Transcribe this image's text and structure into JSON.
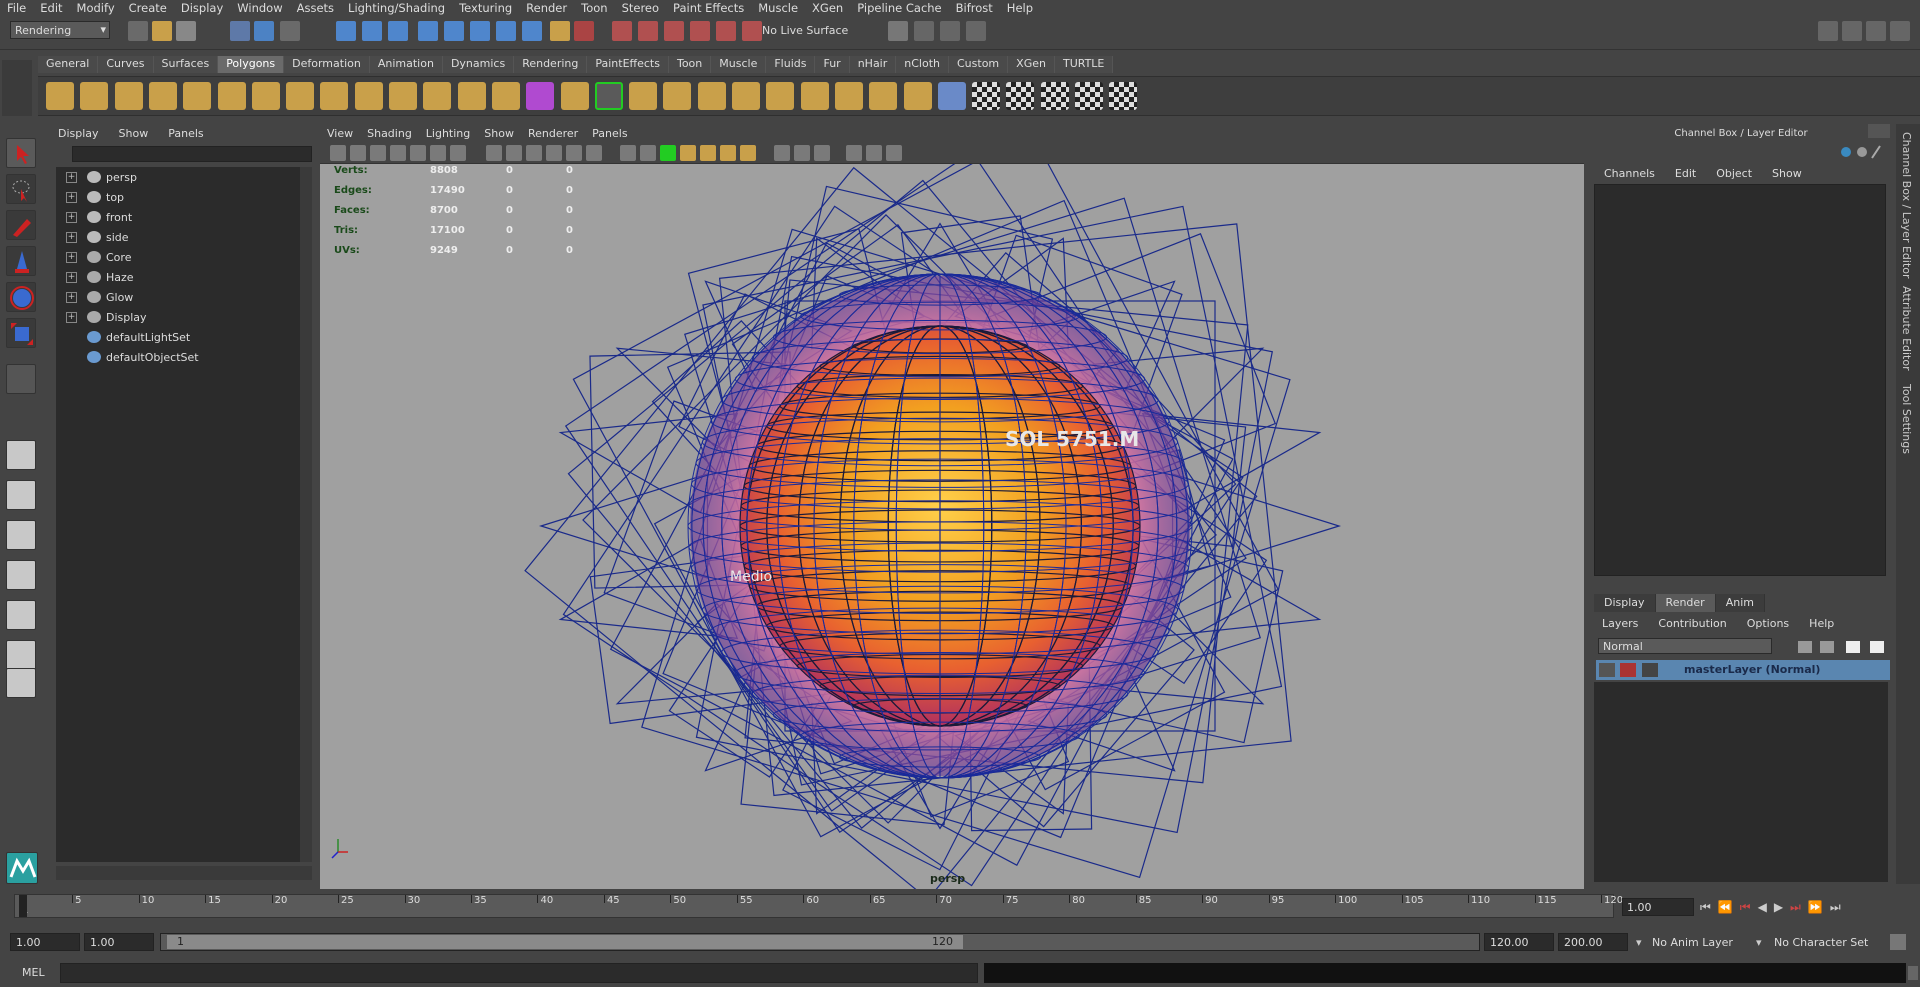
{
  "menubar": {
    "items": [
      "File",
      "Edit",
      "Modify",
      "Create",
      "Display",
      "Window",
      "Assets",
      "Lighting/Shading",
      "Texturing",
      "Render",
      "Toon",
      "Stereo",
      "Paint Effects",
      "Muscle",
      "XGen",
      "Pipeline Cache",
      "Bifrost",
      "Help"
    ]
  },
  "status": {
    "menuset": "Rendering",
    "live_surface": "No Live Surface"
  },
  "shelf": {
    "tabs": [
      "General",
      "Curves",
      "Surfaces",
      "Polygons",
      "Deformation",
      "Animation",
      "Dynamics",
      "Rendering",
      "PaintEffects",
      "Toon",
      "Muscle",
      "Fluids",
      "Fur",
      "nHair",
      "nCloth",
      "Custom",
      "XGen",
      "TURTLE"
    ],
    "active": "Polygons"
  },
  "outliner": {
    "menu": [
      "Display",
      "Show",
      "Panels"
    ],
    "items": [
      {
        "label": "persp",
        "type": "camera",
        "expand": true
      },
      {
        "label": "top",
        "type": "camera",
        "expand": true
      },
      {
        "label": "front",
        "type": "camera",
        "expand": true
      },
      {
        "label": "side",
        "type": "camera",
        "expand": true
      },
      {
        "label": "Core",
        "type": "group",
        "expand": true
      },
      {
        "label": "Haze",
        "type": "group",
        "expand": true
      },
      {
        "label": "Glow",
        "type": "group",
        "expand": true
      },
      {
        "label": "Display",
        "type": "group",
        "expand": true
      },
      {
        "label": "defaultLightSet",
        "type": "set",
        "expand": false
      },
      {
        "label": "defaultObjectSet",
        "type": "set",
        "expand": false
      }
    ]
  },
  "viewport": {
    "menu": [
      "View",
      "Shading",
      "Lighting",
      "Show",
      "Renderer",
      "Panels"
    ],
    "camera_label": "persp",
    "hud": [
      {
        "label": "Verts:",
        "v1": "8808",
        "v2": "0",
        "v3": "0"
      },
      {
        "label": "Edges:",
        "v1": "17490",
        "v2": "0",
        "v3": "0"
      },
      {
        "label": "Faces:",
        "v1": "8700",
        "v2": "0",
        "v3": "0"
      },
      {
        "label": "Tris:",
        "v1": "17100",
        "v2": "0",
        "v3": "0"
      },
      {
        "label": "UVs:",
        "v1": "9249",
        "v2": "0",
        "v3": "0"
      }
    ],
    "scene_text_1": "SOL 5751.M",
    "scene_text_2": "Medio"
  },
  "channel_box": {
    "title": "Channel Box / Layer Editor",
    "menu": [
      "Channels",
      "Edit",
      "Object",
      "Show"
    ],
    "layer_tabs": [
      "Display",
      "Render",
      "Anim"
    ],
    "active_layer_tab": "Render",
    "layer_menu": [
      "Layers",
      "Contribution",
      "Options",
      "Help"
    ],
    "blend_mode": "Normal",
    "layer_name": "masterLayer (Normal)"
  },
  "side_tabs": [
    "Channel Box / Layer Editor",
    "Attribute Editor",
    "Tool Settings"
  ],
  "timeline": {
    "ticks": [
      "1",
      "5",
      "10",
      "15",
      "20",
      "25",
      "30",
      "35",
      "40",
      "45",
      "50",
      "55",
      "60",
      "65",
      "70",
      "75",
      "80",
      "85",
      "90",
      "95",
      "100",
      "105",
      "110",
      "115",
      "120"
    ],
    "current_frame": "1.00"
  },
  "range": {
    "start": "1.00",
    "anim_start": "1.00",
    "slider_start": "1",
    "slider_end": "120",
    "end": "120.00",
    "anim_end": "200.00",
    "anim_layer": "No Anim Layer",
    "char_set": "No Character Set"
  },
  "command": {
    "label": "MEL"
  }
}
